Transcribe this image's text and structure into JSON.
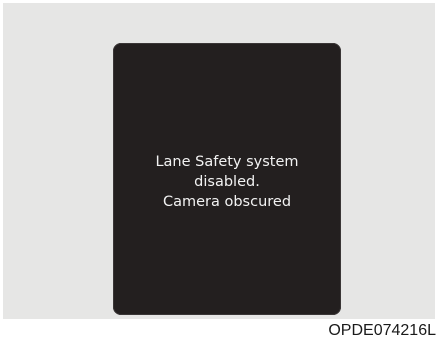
{
  "display": {
    "message_lines": [
      "Lane Safety system",
      "disabled.",
      "Camera obscured"
    ]
  },
  "figure": {
    "code": "OPDE074216L"
  }
}
